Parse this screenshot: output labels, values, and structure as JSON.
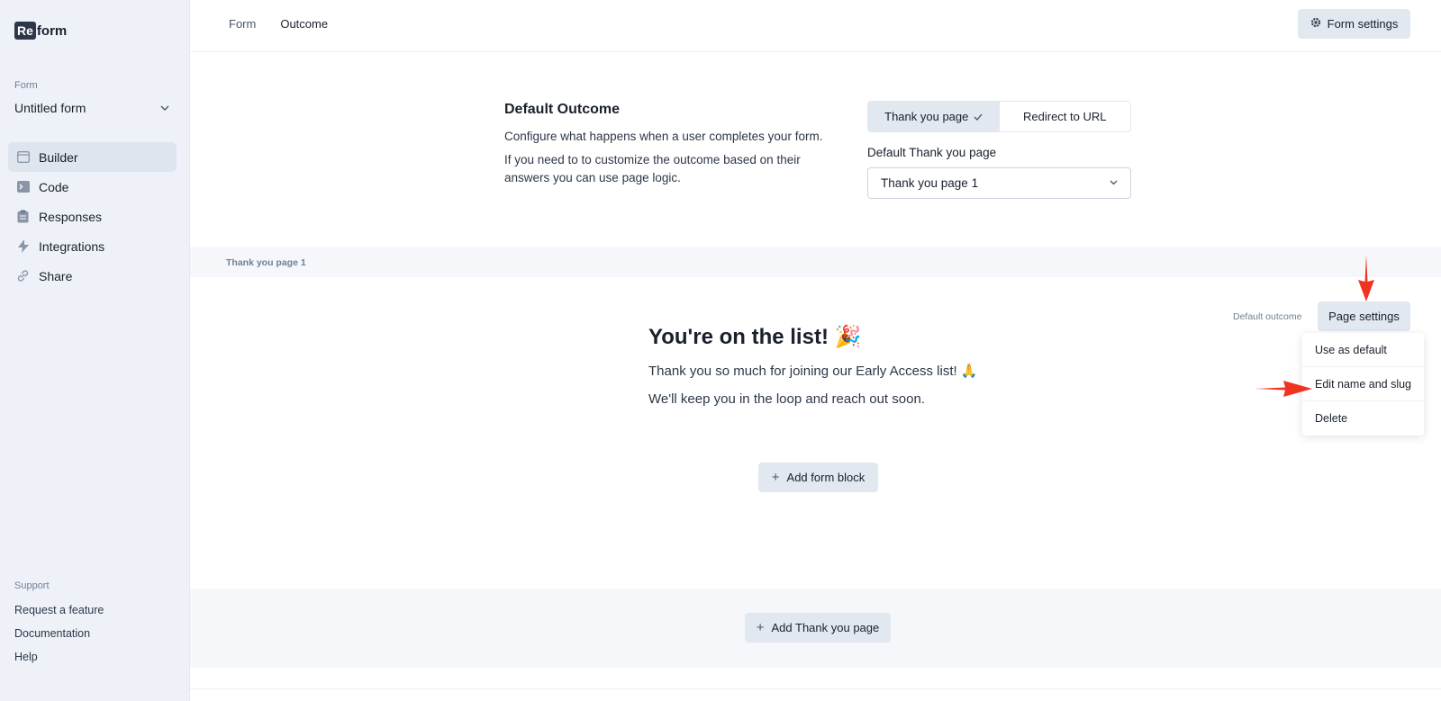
{
  "brand": {
    "logo_re": "Re",
    "logo_rest": "form"
  },
  "sidebar": {
    "form_label": "Form",
    "form_name": "Untitled form",
    "nav": [
      {
        "label": "Builder",
        "icon": "layout-icon"
      },
      {
        "label": "Code",
        "icon": "terminal-icon"
      },
      {
        "label": "Responses",
        "icon": "clipboard-icon"
      },
      {
        "label": "Integrations",
        "icon": "bolt-icon"
      },
      {
        "label": "Share",
        "icon": "link-icon"
      }
    ],
    "support_label": "Support",
    "support_links": [
      "Request a feature",
      "Documentation",
      "Help"
    ]
  },
  "topbar": {
    "crumbs": [
      "Form",
      "Outcome"
    ],
    "form_settings_label": "Form settings"
  },
  "outcome": {
    "title": "Default Outcome",
    "desc1": "Configure what happens when a user completes your form.",
    "desc2": "If you need to to customize the outcome based on their answers you can use page logic.",
    "options": [
      "Thank you page",
      "Redirect to URL"
    ],
    "default_ty_label": "Default Thank you page",
    "default_ty_value": "Thank you page 1"
  },
  "thankyou": {
    "band_label": "Thank you page 1",
    "default_outcome_label": "Default outcome",
    "page_settings_label": "Page settings",
    "menu": [
      "Use as default",
      "Edit name and slug",
      "Delete"
    ],
    "heading": "You're on the list! 🎉",
    "line1": "Thank you so much for joining our Early Access list! 🙏",
    "line2": "We'll keep you in the loop and reach out soon.",
    "add_block_label": "Add form block"
  },
  "footer": {
    "add_ty_label": "Add Thank you page"
  },
  "colors": {
    "accent_arrow": "#f0341f",
    "sidebar_bg": "#eef2f8",
    "button_bg": "#e2e8f0"
  }
}
